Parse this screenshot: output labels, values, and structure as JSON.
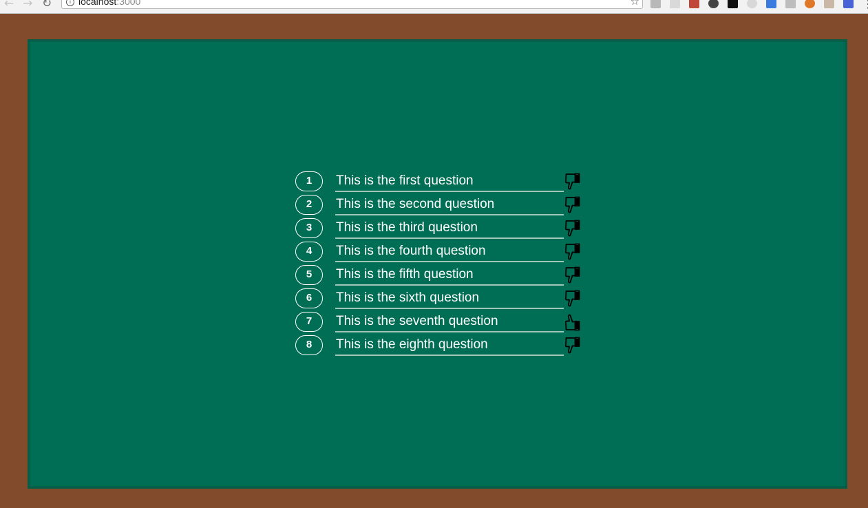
{
  "browser": {
    "url_host": "localhost",
    "url_port": ":3000",
    "nav_icons": [
      "back-arrow-icon",
      "forward-arrow-icon",
      "reload-icon"
    ],
    "info_icon": "i",
    "star_icon": "☆",
    "menu_icon": "⋮"
  },
  "questions": [
    {
      "number": "1",
      "text": "This is the first question",
      "vote": "down"
    },
    {
      "number": "2",
      "text": "This is the second question",
      "vote": "down"
    },
    {
      "number": "3",
      "text": "This is the third question",
      "vote": "down"
    },
    {
      "number": "4",
      "text": "This is the fourth question",
      "vote": "down"
    },
    {
      "number": "5",
      "text": "This is the fifth question",
      "vote": "down"
    },
    {
      "number": "6",
      "text": "This is the sixth question",
      "vote": "down"
    },
    {
      "number": "7",
      "text": "This is the seventh question",
      "vote": "up"
    },
    {
      "number": "8",
      "text": "This is the eighth question",
      "vote": "down"
    }
  ],
  "colors": {
    "frame": "#824b2b",
    "board": "#006e54",
    "chalk": "#ffffff",
    "underline": "#9fc8bb"
  }
}
